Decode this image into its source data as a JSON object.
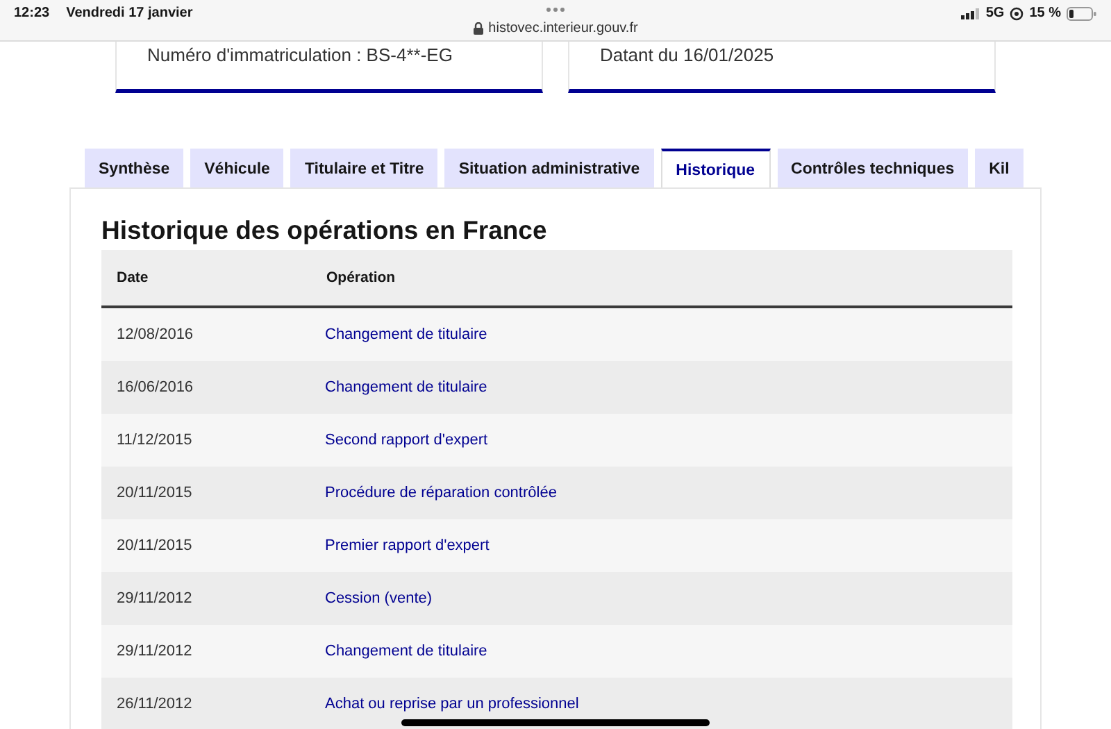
{
  "status_bar": {
    "time": "12:23",
    "date": "Vendredi 17 janvier",
    "url": "histovec.interieur.gouv.fr",
    "network": "5G",
    "battery": "15 %"
  },
  "cards": [
    {
      "text": "Numéro d'immatriculation : BS-4**-EG"
    },
    {
      "text": "Datant du 16/01/2025"
    }
  ],
  "tabs": [
    {
      "label": "Synthèse",
      "selected": false
    },
    {
      "label": "Véhicule",
      "selected": false
    },
    {
      "label": "Titulaire et Titre",
      "selected": false
    },
    {
      "label": "Situation administrative",
      "selected": false
    },
    {
      "label": "Historique",
      "selected": true
    },
    {
      "label": "Contrôles techniques",
      "selected": false
    },
    {
      "label": "Kil",
      "selected": false
    }
  ],
  "section_title": "Historique des opérations en France",
  "table": {
    "columns": [
      "Date",
      "Opération"
    ],
    "rows": [
      [
        "12/08/2016",
        "Changement de titulaire"
      ],
      [
        "16/06/2016",
        "Changement de titulaire"
      ],
      [
        "11/12/2015",
        "Second rapport d'expert"
      ],
      [
        "20/11/2015",
        "Procédure de réparation contrôlée"
      ],
      [
        "20/11/2015",
        "Premier rapport d'expert"
      ],
      [
        "29/11/2012",
        "Cession (vente)"
      ],
      [
        "29/11/2012",
        "Changement de titulaire"
      ],
      [
        "26/11/2012",
        "Achat ou reprise par un professionnel"
      ]
    ]
  }
}
